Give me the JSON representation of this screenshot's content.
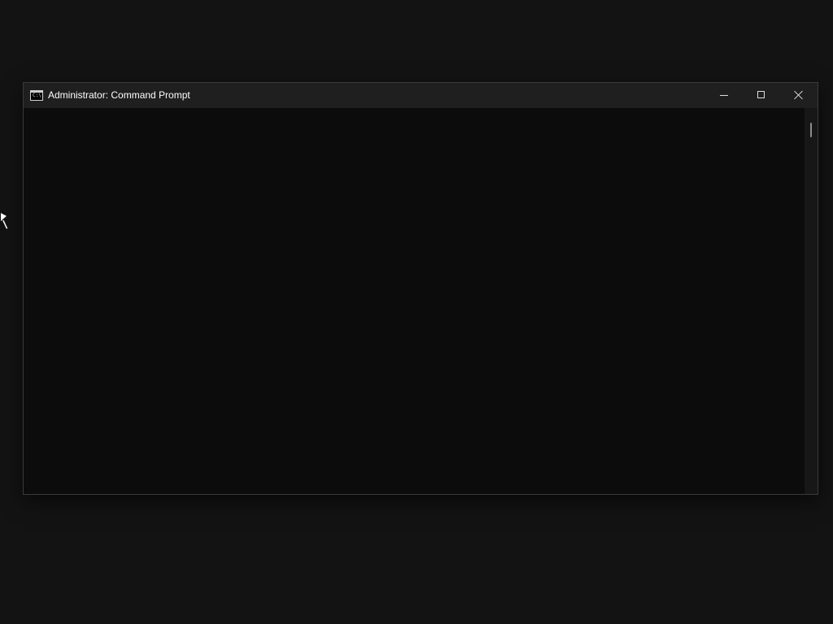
{
  "window": {
    "title": "Administrator: Command Prompt",
    "app_icon_text": "C:\\."
  },
  "console": {
    "text": ""
  },
  "icons": {
    "app": "command-prompt-icon",
    "minimize": "minimize-icon",
    "maximize": "maximize-icon",
    "close": "close-icon",
    "cursor": "mouse-cursor-icon"
  },
  "colors": {
    "desktop": "#131313",
    "titlebar": "#1f1f1f",
    "console_background": "#0c0c0c",
    "text": "#ffffff",
    "scrollbar_thumb": "#8d8d8d"
  }
}
